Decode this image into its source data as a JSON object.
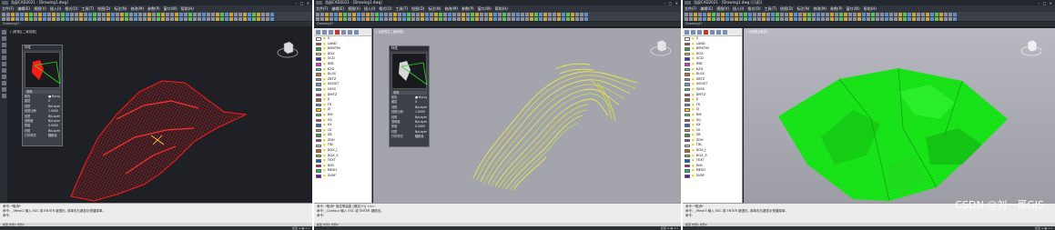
{
  "windows": [
    {
      "title": "浩辰CAD2021 - [Drawing1.dwg]",
      "viewport_label": "[-]俯视][二维线框]"
    },
    {
      "title": "浩辰CAD2021 - [Drawing1.dwg]",
      "viewport_label": "[-][俯视][二维线框]"
    },
    {
      "title": "浩辰CAD2021 - [Drawing1.dwg (只读)]",
      "viewport_label": "[-][俯视][真实]"
    }
  ],
  "window_buttons": "– □ ✕",
  "menu_items": [
    "文件(F)",
    "编辑(E)",
    "视图(V)",
    "插入(I)",
    "格式(O)",
    "工具(T)",
    "绘图(D)",
    "标注(N)",
    "修改(M)",
    "参数(P)",
    "窗口(W)",
    "帮助(H)"
  ],
  "document_tab": "Drawing1*",
  "props_panel": {
    "title": "特性",
    "section": "常规",
    "rows": [
      {
        "k": "颜色",
        "v": "■ ByLayer"
      },
      {
        "k": "图层",
        "v": "0"
      },
      {
        "k": "线型",
        "v": "ByLayer"
      },
      {
        "k": "线型比例",
        "v": "1.0000"
      },
      {
        "k": "线宽",
        "v": "ByLayer"
      },
      {
        "k": "透明度",
        "v": "ByLayer"
      },
      {
        "k": "厚度",
        "v": "0.0000"
      },
      {
        "k": "材质",
        "v": "ByLayer"
      },
      {
        "k": "打印样式",
        "v": "随颜色"
      }
    ]
  },
  "layers": [
    {
      "name": "0",
      "color": "#ffffff"
    },
    {
      "name": "LAND",
      "color": "#d33"
    },
    {
      "name": "DMXTIN",
      "color": "#3a3"
    },
    {
      "name": "DGX",
      "color": "#cc3"
    },
    {
      "name": "GCD",
      "color": "#33c"
    },
    {
      "name": "JMD",
      "color": "#d3d"
    },
    {
      "name": "KZD",
      "color": "#3cc"
    },
    {
      "name": "DLSS",
      "color": "#c63"
    },
    {
      "name": "ZBTZ",
      "color": "#999"
    },
    {
      "name": "ASSIST",
      "color": "#69c"
    },
    {
      "name": "SXSS",
      "color": "#3c9"
    },
    {
      "name": "DMTZ",
      "color": "#c39"
    },
    {
      "name": "JJ",
      "color": "#963"
    },
    {
      "name": "TK",
      "color": "#39c"
    },
    {
      "name": "ZJ",
      "color": "#fc0"
    },
    {
      "name": "DM",
      "color": "#6c3"
    },
    {
      "name": "SQ",
      "color": "#c36"
    },
    {
      "name": "XX",
      "color": "#36c"
    },
    {
      "name": "CK",
      "color": "#c93"
    },
    {
      "name": "ZB",
      "color": "#393"
    },
    {
      "name": "ZDH",
      "color": "#939"
    },
    {
      "name": "TIN",
      "color": "#ccc"
    },
    {
      "name": "DGX_J",
      "color": "#c60"
    },
    {
      "name": "DGX_S",
      "color": "#6c0"
    },
    {
      "name": "TEXT",
      "color": "#06c"
    },
    {
      "name": "DIM",
      "color": "#c06"
    },
    {
      "name": "MESH",
      "color": "#0c6"
    },
    {
      "name": "SURF",
      "color": "#60c"
    }
  ],
  "command_lines_1": [
    "命令: *取消*",
    "命令: _.Mesh2 输入 ESC 或 ENTER 键退出, 或单击右键显示快捷菜单。",
    "命令:"
  ],
  "command_lines_2": [
    "命令: *取消*  指定等高距 [确定(Y)] <1>:",
    "命令: _Contour 输入 ESC 或 ENTER 键退出。",
    "命令:"
  ],
  "command_lines_3": [
    "命令: *取消*",
    "命令: _.Mesh3 输入 ESC 或 ENTER 键退出, 或单击右键显示快捷菜单。",
    "命令:"
  ],
  "layout_tabs": "模型  布局1  布局2",
  "status_right": "模型  ≡  ▦  1:1",
  "watermark": "CSDN @刘一哥GIS",
  "logo_text": "@ 浩",
  "colors": {
    "mesh_red": "#ff1a1a",
    "contour_yellow": "#e8e84a",
    "surface_green": "#19e619",
    "dark_bg": "#1e2025",
    "gray_bg": "#a3a4ac"
  }
}
